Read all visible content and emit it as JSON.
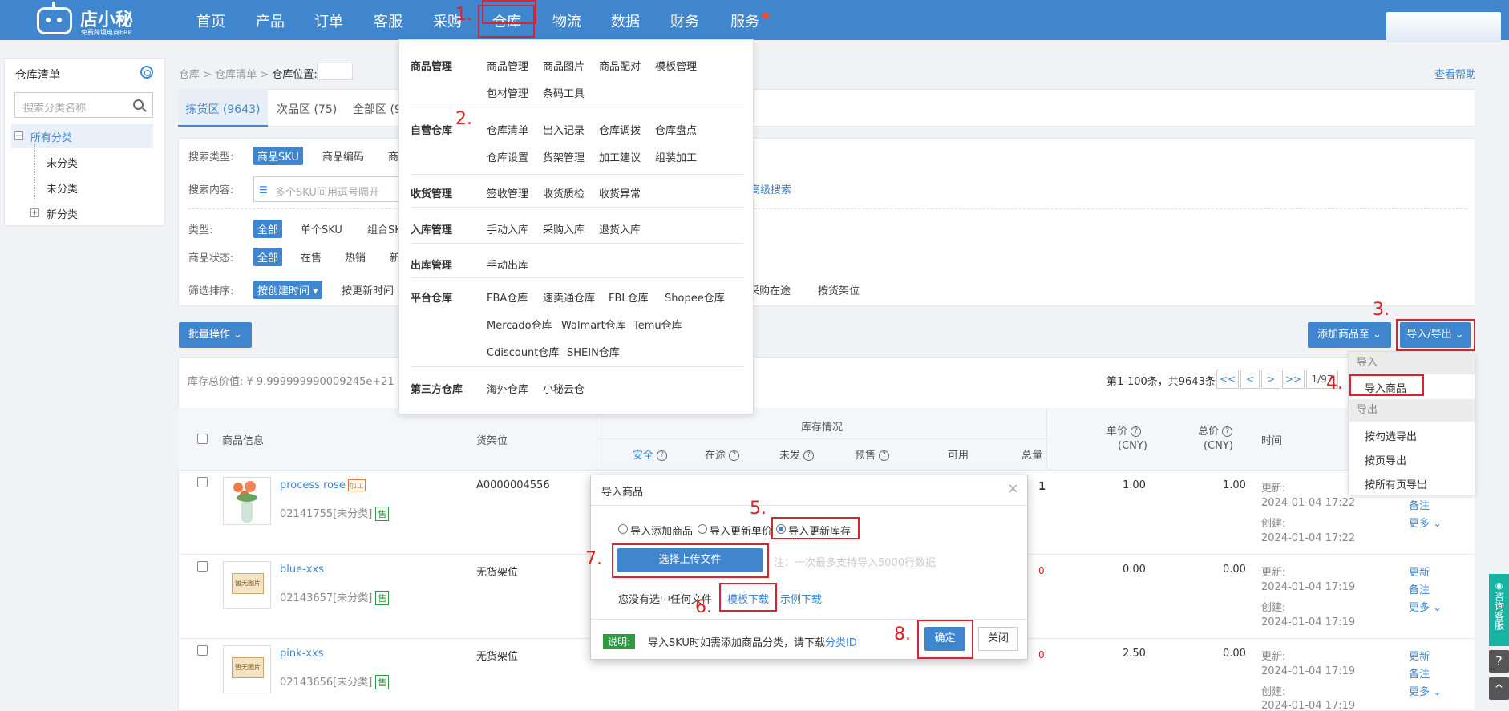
{
  "app": {
    "logo_name": "店小秘",
    "logo_tag": "免费跨境电商ERP"
  },
  "nav": {
    "items": [
      "首页",
      "产品",
      "订单",
      "客服",
      "采购",
      "仓库",
      "物流",
      "数据",
      "财务",
      "服务"
    ]
  },
  "steps": [
    "1.",
    "2.",
    "3.",
    "4.",
    "5.",
    "6.",
    "7.",
    "8."
  ],
  "sidebar": {
    "title": "仓库清单",
    "search_placeholder": "搜索分类名称",
    "tree": [
      {
        "label": "所有分类",
        "expand": "−"
      },
      {
        "label": "未分类"
      },
      {
        "label": "未分类"
      },
      {
        "label": "新分类",
        "expand": "+"
      }
    ]
  },
  "breadcrumb": {
    "text": "仓库 > 仓库清单 > ",
    "location_label": "仓库位置:"
  },
  "help": "查看帮助",
  "tabs": [
    "拣货区 (9643)",
    "次品区 (75)",
    "全部区 (9"
  ],
  "filters": {
    "search_type_label": "搜索类型:",
    "search_types": [
      "商品SKU",
      "商品编码",
      "商"
    ],
    "content_label": "搜索内容:",
    "content_placeholder": "多个SKU间用逗号隔开",
    "advanced": "高级搜索",
    "type_label": "类型:",
    "types": [
      "全部",
      "单个SKU",
      "组合SK"
    ],
    "status_label": "商品状态:",
    "statuses": [
      "全部",
      "在售",
      "热销",
      "新"
    ],
    "sort_label": "筛选排序:",
    "sorts": [
      "按创建时间 ▾",
      "按更新时间",
      "采购在途",
      "按货架位"
    ]
  },
  "toolbar": {
    "batch": "批量操作 ⌄",
    "add_to": "添加商品至 ⌄",
    "import_export": "导入/导出 ⌄"
  },
  "summary": {
    "stock_value": "库存总价值: ¥ 9.999999990009245e+21",
    "pager_info": "第1-100条，共9643条",
    "pager_btns": [
      "<<",
      "<",
      ">",
      ">>",
      "1/97"
    ]
  },
  "menu": {
    "groups": [
      {
        "title": "商品管理",
        "items": [
          "商品管理",
          "商品图片",
          "商品配对",
          "模板管理",
          "包材管理",
          "条码工具"
        ]
      },
      {
        "title": "自营仓库",
        "items": [
          "仓库清单",
          "出入记录",
          "仓库调拨",
          "仓库盘点",
          "仓库设置",
          "货架管理",
          "加工建议",
          "组装加工"
        ]
      },
      {
        "title": "收货管理",
        "items": [
          "签收管理",
          "收货质检",
          "收货异常"
        ]
      },
      {
        "title": "入库管理",
        "items": [
          "手动入库",
          "采购入库",
          "退货入库"
        ]
      },
      {
        "title": "出库管理",
        "items": [
          "手动出库"
        ]
      },
      {
        "title": "平台仓库",
        "items": [
          "FBA仓库",
          "速卖通仓库",
          "FBL仓库",
          "Shopee仓库",
          "Mercado仓库",
          "Walmart仓库",
          "Temu仓库",
          "Cdiscount仓库",
          "SHEIN仓库"
        ]
      },
      {
        "title": "第三方仓库",
        "items": [
          "海外仓库",
          "小秘云仓"
        ]
      }
    ]
  },
  "table": {
    "headers": {
      "product": "商品信息",
      "shelf": "货架位",
      "stock": "库存情况",
      "safe": "安全",
      "transit": "在途",
      "unshipped": "未发",
      "presale": "预售",
      "available": "可用",
      "total": "总量",
      "unit_price": "单价",
      "total_price": "总价",
      "cny": "(CNY)",
      "time": "时间"
    },
    "rows": [
      {
        "name": "process rose",
        "tag": "加工",
        "sku": "02141755[未分类]",
        "badge": "售",
        "shelf": "A0000004556",
        "total": "1",
        "unit_price": "1.00",
        "total_price": "1.00",
        "updated_label": "更新:",
        "updated": "2024-01-04 17:22",
        "created_label": "创建:",
        "created": "2024-01-04 17:22",
        "actions": [
          "备注",
          "更多 ⌄"
        ]
      },
      {
        "name": "blue-xxs",
        "sku": "02143657[未分类]",
        "badge": "售",
        "shelf": "无货架位",
        "total": "0",
        "unit_price": "0.00",
        "total_price": "0.00",
        "updated_label": "更新:",
        "updated": "2024-01-04 17:19",
        "created_label": "创建:",
        "created": "2024-01-04 17:19",
        "actions": [
          "更新",
          "备注",
          "更多 ⌄"
        ],
        "placeholder": "暂无图片"
      },
      {
        "name": "pink-xxs",
        "sku": "02143656[未分类]",
        "badge": "售",
        "shelf": "无货架位",
        "total": "0",
        "unit_price": "2.50",
        "total_price": "0.00",
        "updated_label": "更新:",
        "updated": "2024-01-04 17:19",
        "created_label": "创建:",
        "created": "2024-01-04 17:19",
        "actions": [
          "更新",
          "备注",
          "更多 ⌄"
        ],
        "placeholder": "暂无图片"
      }
    ]
  },
  "export_menu": {
    "import_head": "导入",
    "import_item": "导入商品",
    "export_head": "导出",
    "export_items": [
      "按勾选导出",
      "按页导出",
      "按所有页导出"
    ]
  },
  "modal": {
    "title": "导入商品",
    "close": "×",
    "radios": [
      "导入添加商品",
      "导入更新单价",
      "导入更新库存"
    ],
    "upload": "选择上传文件",
    "note": "注：一次最多支持导入5000行数据",
    "no_file": "您没有选中任何文件",
    "template_dl": "模板下载",
    "example_dl": "示例下载",
    "explain_tag": "说明:",
    "explain": "导入SKU时如需添加商品分类，请下载",
    "category_id": "分类ID",
    "confirm": "确定",
    "cancel": "关闭"
  },
  "side": {
    "kefu": "咨询客服",
    "help_icon": "?",
    "top_icon": "^"
  },
  "colors": {
    "brand": "#3f86cf",
    "highlight": "#d9232f",
    "sale_badge": "#2e9b3e",
    "zero": "#e02020"
  }
}
